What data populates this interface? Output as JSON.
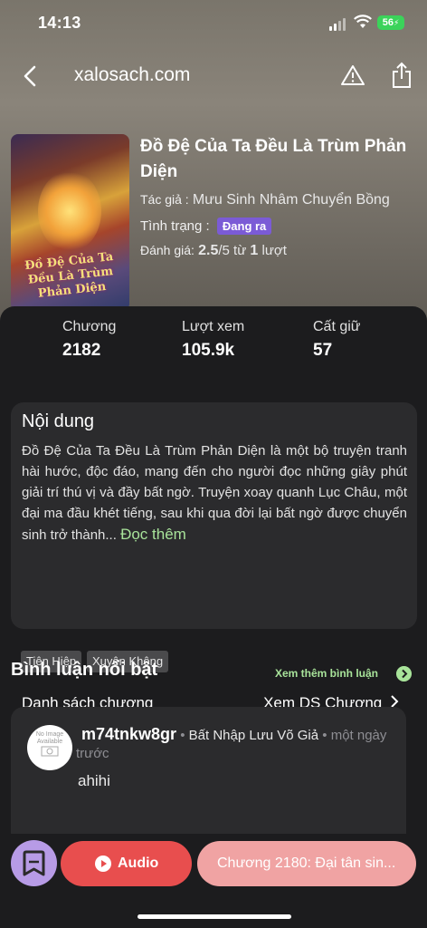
{
  "status_bar": {
    "time": "14:13",
    "battery": "56"
  },
  "nav": {
    "domain": "xalosach.com",
    "icons": [
      "back-arrow-icon",
      "warning-icon",
      "share-icon"
    ]
  },
  "book": {
    "cover_text": "Đồ Đệ Của Ta Đều Là Trùm Phản Diện",
    "title": "Đồ Đệ Của Ta Đều Là Trùm Phản Diện",
    "author_label": "Tác giả :",
    "author": "Mưu Sinh Nhâm Chuyển Bồng",
    "status_label": "Tình trạng :",
    "status": "Đang ra",
    "rating_label": "Đánh giá:",
    "rating": "2.5",
    "rating_scale": "/5 từ",
    "rating_count": "1",
    "rating_unit": "lượt"
  },
  "stats": [
    {
      "label": "Chương",
      "value": "2182"
    },
    {
      "label": "Lượt xem",
      "value": "105.9k"
    },
    {
      "label": "Cất giữ",
      "value": "57"
    }
  ],
  "content": {
    "title": "Nội dung",
    "description": "Đồ Đệ Của Ta Đều Là Trùm Phản Diện là một bộ truyện tranh hài hước, độc đáo, mang đến cho người đọc những giây phút giải trí thú vị và đầy bất ngờ. Truyện xoay quanh Lục Châu, một đại ma đầu khét tiếng, sau khi qua đời lại bất ngờ được chuyển sinh trở thành...",
    "read_more": "Đọc thêm",
    "tags": [
      "Tiên Hiệp",
      "Xuyên Không"
    ],
    "chapter_list_label": "Danh sách chương",
    "chapter_list_link": "Xem DS Chương"
  },
  "comments": {
    "title": "Bình luận nổi bật",
    "more_link": "Xem thêm bình luận",
    "items": [
      {
        "avatar_text": "No Image Available",
        "username": "m74tnkw8gr",
        "book": "Bất Nhập Lưu Võ Giả",
        "time": "một ngày trước",
        "text": "ahihi"
      }
    ]
  },
  "actions": {
    "audio_label": "Audio",
    "chapter_label": "Chương 2180: Đại tân sin..."
  },
  "colors": {
    "accent_green": "#a8e39a",
    "audio_red": "#e84e4e",
    "chapter_pink": "#f0a3a3",
    "badge_purple": "#7b5bd6",
    "bookmark_purple": "#b79be6"
  }
}
